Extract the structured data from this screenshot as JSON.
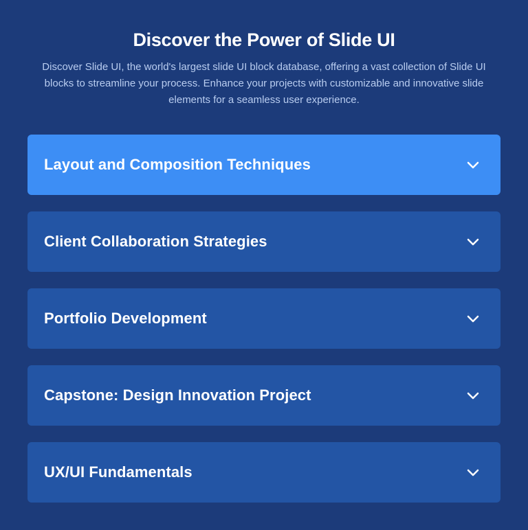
{
  "header": {
    "title": "Discover the Power of Slide UI",
    "subtitle": "Discover Slide UI, the world's largest slide UI block database, offering a vast collection of Slide UI blocks to streamline your process. Enhance your projects with customizable and innovative slide elements for a seamless user experience."
  },
  "accordion": {
    "items": [
      {
        "label": "Layout and Composition Techniques",
        "active": true,
        "icon": "chevron-down-icon"
      },
      {
        "label": "Client Collaboration Strategies",
        "active": false,
        "icon": "chevron-down-icon"
      },
      {
        "label": "Portfolio Development",
        "active": false,
        "icon": "chevron-down-icon"
      },
      {
        "label": "Capstone: Design Innovation Project",
        "active": false,
        "icon": "chevron-down-icon"
      },
      {
        "label": "UX/UI Fundamentals",
        "active": false,
        "icon": "chevron-down-icon"
      }
    ]
  },
  "colors": {
    "background": "#1c3b7a",
    "item": "#2355a5",
    "item_active": "#3d8ef5",
    "subtitle": "#b9cdf0"
  }
}
